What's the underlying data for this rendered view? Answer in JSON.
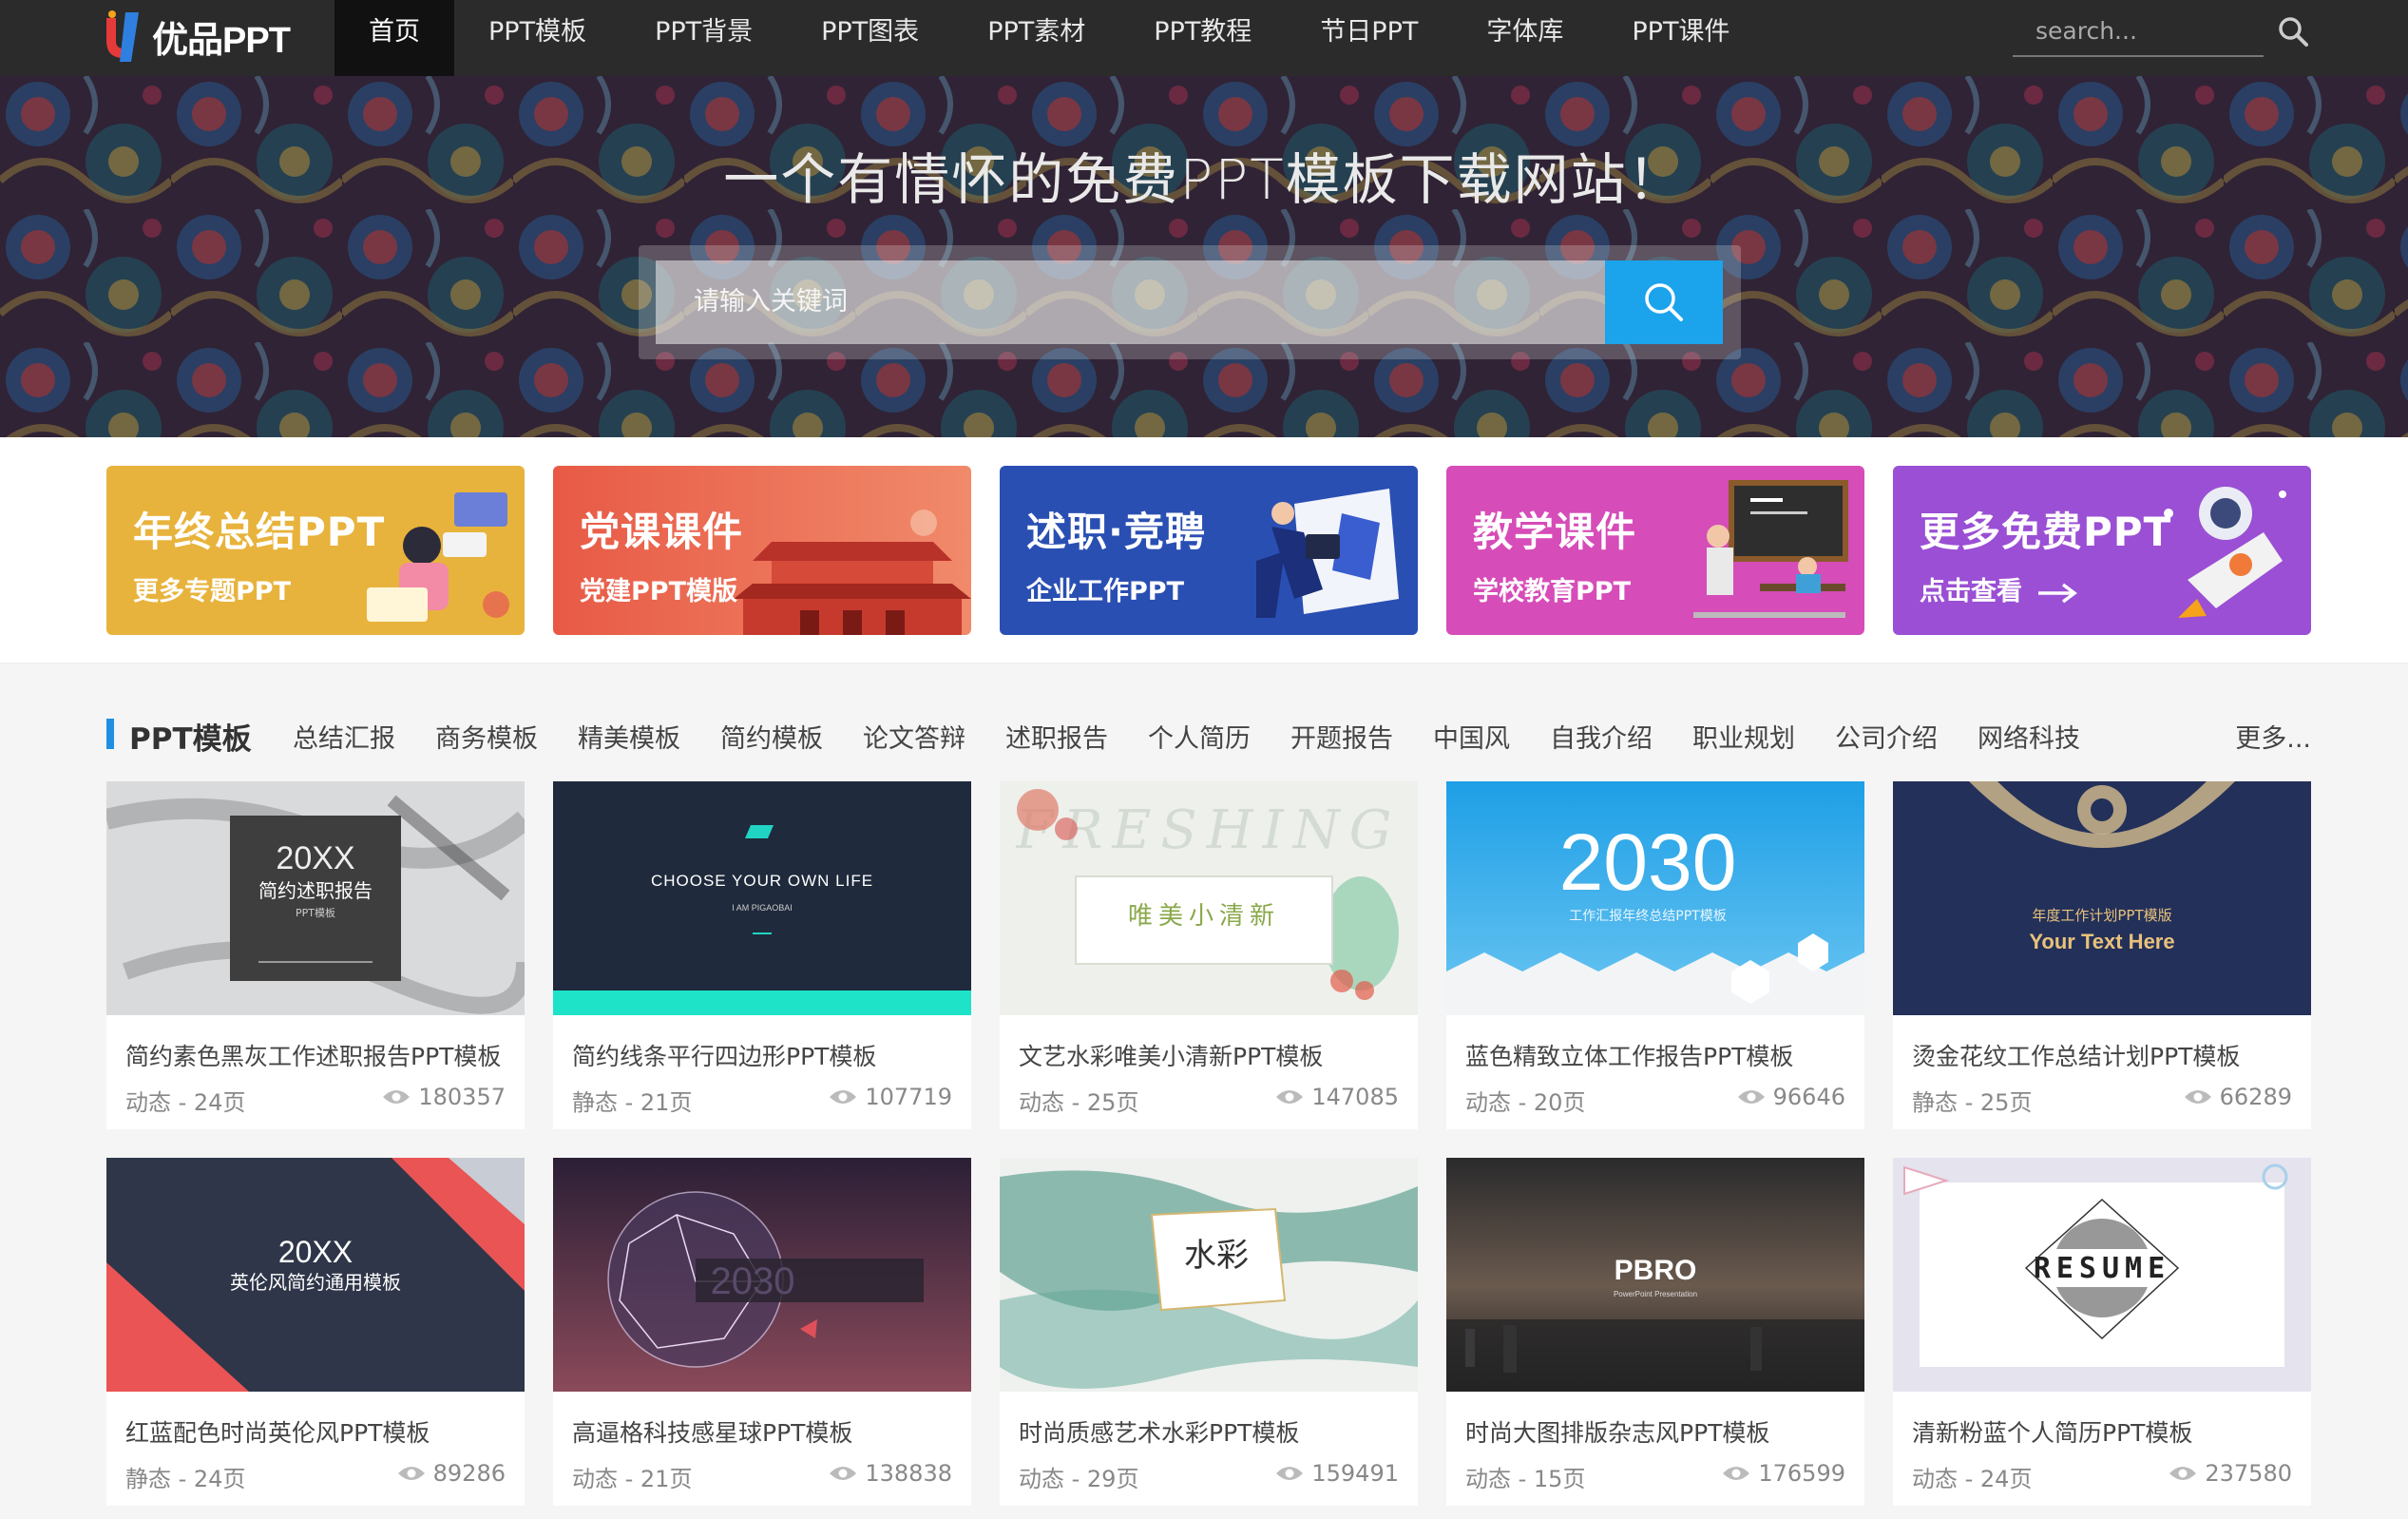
{
  "nav": {
    "logo_text": "优品PPT",
    "menu": [
      "首页",
      "PPT模板",
      "PPT背景",
      "PPT图表",
      "PPT素材",
      "PPT教程",
      "节日PPT",
      "字体库",
      "PPT课件"
    ],
    "search_placeholder": "search..."
  },
  "hero": {
    "title": "一个有情怀的免费PPT模板下载网站！",
    "search_placeholder": "请输入关键词"
  },
  "banners": [
    {
      "title": "年终总结PPT",
      "sub": "更多专题PPT"
    },
    {
      "title": "党课课件",
      "sub": "党建PPT模版"
    },
    {
      "title": "述职·竞聘",
      "sub": "企业工作PPT"
    },
    {
      "title": "教学课件",
      "sub": "学校教育PPT"
    },
    {
      "title": "更多免费PPT",
      "sub": "点击查看"
    }
  ],
  "section": {
    "title": "PPT模板",
    "tags": [
      "总结汇报",
      "商务模板",
      "精美模板",
      "简约模板",
      "论文答辩",
      "述职报告",
      "个人简历",
      "开题报告",
      "中国风",
      "自我介绍",
      "职业规划",
      "公司介绍",
      "网络科技"
    ],
    "more": "更多..."
  },
  "thumbs": {
    "t1a": "20XX",
    "t1b": "简约述职报告",
    "t1c": "PPT模板",
    "t2a": "CHOOSE YOUR OWN LIFE",
    "t2b": "I AM PIGAOBAI",
    "t3a": "FRESHING",
    "t3b": "唯美小清新",
    "t4a": "2030",
    "t4b": "工作汇报年终总结PPT模板",
    "t5a": "年度工作计划PPT模版",
    "t5b": "Your Text Here",
    "t6a": "20XX",
    "t6b": "英伦风简约通用模板",
    "t7a": "2030",
    "t8a": "水彩",
    "t9a": "PBRO",
    "t9b": "PowerPoint Presentation",
    "t10a": "RESUME"
  },
  "cards": [
    {
      "title": "简约素色黑灰工作述职报告PPT模板",
      "meta": "动态 - 24页",
      "views": "180357"
    },
    {
      "title": "简约线条平行四边形PPT模板",
      "meta": "静态 - 21页",
      "views": "107719"
    },
    {
      "title": "文艺水彩唯美小清新PPT模板",
      "meta": "动态 - 25页",
      "views": "147085"
    },
    {
      "title": "蓝色精致立体工作报告PPT模板",
      "meta": "动态 - 20页",
      "views": "96646"
    },
    {
      "title": "烫金花纹工作总结计划PPT模板",
      "meta": "静态 - 25页",
      "views": "66289"
    },
    {
      "title": "红蓝配色时尚英伦风PPT模板",
      "meta": "静态 - 24页",
      "views": "89286"
    },
    {
      "title": "高逼格科技感星球PPT模板",
      "meta": "动态 - 21页",
      "views": "138838"
    },
    {
      "title": "时尚质感艺术水彩PPT模板",
      "meta": "动态 - 29页",
      "views": "159491"
    },
    {
      "title": "时尚大图排版杂志风PPT模板",
      "meta": "动态 - 15页",
      "views": "176599"
    },
    {
      "title": "清新粉蓝个人简历PPT模板",
      "meta": "动态 - 24页",
      "views": "237580"
    }
  ],
  "colors": {
    "accent": "#1ba3ec",
    "nav_bg": "#2b2b2b",
    "section_bar": "#1e8fe1"
  }
}
